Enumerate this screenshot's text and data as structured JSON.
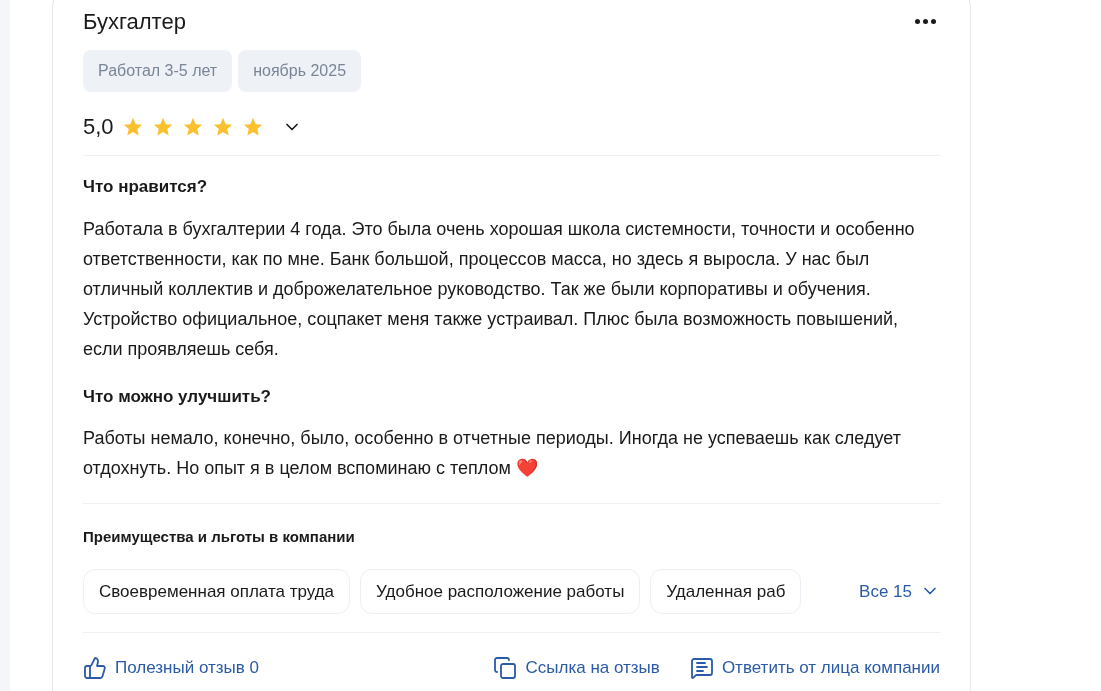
{
  "review": {
    "title": "Бухгалтер",
    "tags": [
      "Работал 3-5 лет",
      "ноябрь 2025"
    ],
    "rating": "5,0",
    "stars": 5,
    "sections": [
      {
        "heading": "Что нравится?",
        "text": "Работала в бухгалтерии 4 года. Это была очень хорошая школа системности, точности и особенно ответственности, как по мне. Банк большой, процессов масса, но здесь я выросла. У нас был отличный коллектив и доброжелательное руководство. Так же были корпоративы и обучения. Устройство официальное, соцпакет меня также устраивал. Плюс была возможность повышений, если проявляешь себя."
      },
      {
        "heading": "Что можно улучшить?",
        "text": "Работы немало, конечно, было, особенно в отчетные периоды. Иногда не успеваешь как следует отдохнуть. Но опыт я в целом вспоминаю с теплом",
        "emoji": "❤️"
      }
    ],
    "benefits": {
      "heading": "Преимущества и льготы в компании",
      "items": [
        "Своевременная оплата труда",
        "Удобное расположение работы",
        "Удаленная раб"
      ],
      "more": "Все 15"
    },
    "actions": [
      {
        "kind": "like",
        "label": "Полезный отзыв 0"
      },
      {
        "kind": "link",
        "label": "Ссылка на отзыв"
      },
      {
        "kind": "reply",
        "label": "Ответить от лица компании"
      }
    ]
  }
}
